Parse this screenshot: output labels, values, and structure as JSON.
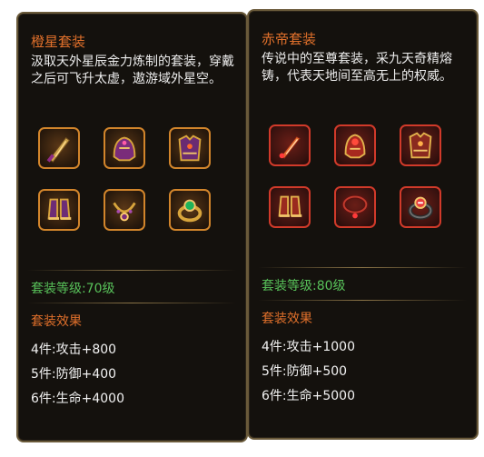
{
  "left": {
    "title": "橙星套装",
    "desc": "汲取天外星辰金力炼制的套装，穿戴之后可飞升太虚，遨游域外星空。",
    "items": [
      "sword-icon",
      "helmet-icon",
      "armor-icon",
      "boots-icon",
      "necklace-icon",
      "ring-icon"
    ],
    "level": "套装等级:70级",
    "effect_title": "套装效果",
    "effects": [
      "4件:攻击+800",
      "5件:防御+400",
      "6件:生命+4000"
    ],
    "colors": {
      "title": "#e0702b",
      "level": "#58c25a",
      "frame": "#d2852b"
    }
  },
  "right": {
    "title": "赤帝套装",
    "desc": "传说中的至尊套装，采九天奇精熔铸，代表天地间至高无上的权威。",
    "items": [
      "sword-icon",
      "helmet-icon",
      "armor-icon",
      "boots-icon",
      "necklace-icon",
      "ring-icon"
    ],
    "level": "套装等级:80级",
    "effect_title": "套装效果",
    "effects": [
      "4件:攻击+1000",
      "5件:防御+500",
      "6件:生命+5000"
    ],
    "colors": {
      "title": "#e0702b",
      "level": "#58c25a",
      "frame": "#d13a2a"
    }
  }
}
